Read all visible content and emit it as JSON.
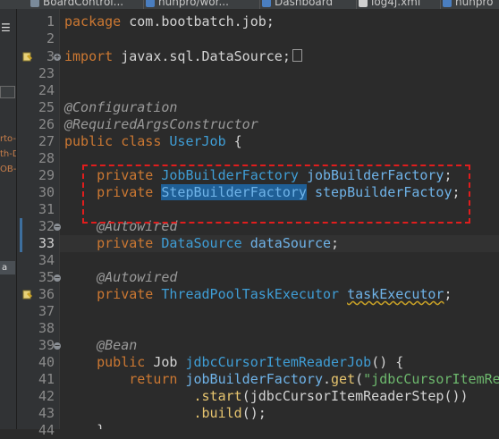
{
  "tabs": [
    {
      "label": "BoardControl...",
      "icon": "java-file-icon"
    },
    {
      "label": "hunpro/wor...",
      "icon": "folder-icon"
    },
    {
      "label": "Dashboard",
      "icon": "dashboard-icon"
    },
    {
      "label": "log4j.xml",
      "icon": "xml-file-icon"
    },
    {
      "label": "hunpro",
      "icon": "folder-icon"
    }
  ],
  "left_panel": {
    "menu_glyph": "☰",
    "fragments": [
      "rto-D",
      "th-D",
      "OB-"
    ],
    "selected_label": "a"
  },
  "gutter": {
    "line_numbers": [
      "1",
      "2",
      "3",
      "23",
      "24",
      "25",
      "26",
      "27",
      "28",
      "29",
      "30",
      "31",
      "32",
      "33",
      "34",
      "35",
      "36",
      "37",
      "38",
      "39",
      "40",
      "41",
      "42",
      "43",
      "44"
    ],
    "current_line": "33"
  },
  "code": {
    "l1": {
      "kw": "package",
      "rest": " com.bootbatch.job;"
    },
    "l3": {
      "kw": "import",
      "rest": " javax.sql.DataSource;"
    },
    "l25": {
      "anno": "@Configuration"
    },
    "l26": {
      "anno": "@RequiredArgsConstructor"
    },
    "l27": {
      "kw": "public",
      "kw2": "class",
      "name": "UserJob",
      "rest": " {"
    },
    "l29": {
      "kw": "private",
      "type": "JobBuilderFactory",
      "field": "jobBuilderFactory",
      "rest": ";"
    },
    "l30": {
      "kw": "private",
      "type": "StepBuilderFactory",
      "field": "stepBuilderFactoy",
      "rest": ";"
    },
    "l32": {
      "anno": "@Autowired"
    },
    "l33": {
      "kw": "private",
      "type": "DataSource",
      "field": "dataSource",
      "rest": ";"
    },
    "l35": {
      "anno": "@Autowired"
    },
    "l36": {
      "kw": "private",
      "type": "ThreadPoolTaskExecutor",
      "field": "taskExecutor",
      "rest": ";"
    },
    "l39": {
      "anno": "@Bean"
    },
    "l40": {
      "kw": "public",
      "type": "Job",
      "method": "jdbcCursorItemReaderJob",
      "rest": "() {"
    },
    "l41": {
      "kw": "return",
      "field": "jobBuilderFactory",
      "dot": ".",
      "method": "get",
      "open": "(",
      "string": "\"jdbcCursorItemReaderJob\"",
      "close": ")"
    },
    "l42": {
      "method": ".start",
      "open": "(",
      "call": "jdbcCursorItemReaderStep",
      "close": "())"
    },
    "l43": {
      "method": ".build",
      "rest": "();"
    },
    "l44": {
      "rest": "}"
    }
  },
  "colors": {
    "background": "#2b2b2b",
    "keyword": "#cc7832",
    "type": "#3f9ed6",
    "annotation": "#9a9a9a",
    "string": "#6db86d",
    "highlight_box": "#e11d1d",
    "selection": "#1f5f96"
  }
}
